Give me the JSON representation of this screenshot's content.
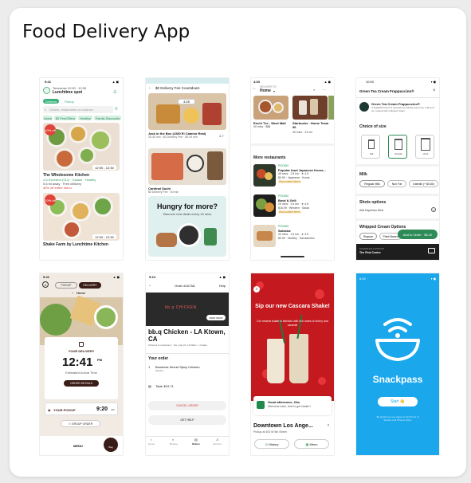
{
  "page": {
    "title": "Food Delivery App"
  },
  "s1": {
    "time": "9:41",
    "schedule": "Tomorrow 12:00 - 12:30",
    "place": "Lunchtime spot",
    "tabs": [
      "Delivery",
      "Pickup"
    ],
    "search_placeholder": "Dishes, restaurants or cuisines",
    "filters": [
      "Asian",
      "$0 Fee/Offers",
      "Healthy",
      "Family Discounts"
    ],
    "card1": {
      "promo": "40% off",
      "eta": "12:00 - 12:30",
      "name": "The Wholesome Kitchen",
      "rating": "4.8 Excellent (512) · Salads · Healthy",
      "meta": "0.6 mi away · Free delivery",
      "offer": "40% off entire menu"
    },
    "card2": {
      "promo": "20% off",
      "eta": "12:00 - 12:30",
      "name": "Shake Farm by Lunchtime Kitchen"
    }
  },
  "s2": {
    "header": "$0 Delivery Fee Countdown",
    "timer": "4:28",
    "item1": {
      "name": "Jack in the Box (2280 El Camino Real)",
      "meta": "25-40 min · $0 Delivery Fee · $0.49 min",
      "rating": "4.7"
    },
    "item2": {
      "name": "Cardinal Sushi",
      "meta": "$0 Delivery Fee · 40 min"
    },
    "promo": {
      "title": "Hungry for more?",
      "sub": "Discover new deals every 15 mins"
    }
  },
  "s3": {
    "time": "4:03",
    "deliver_label": "DELIVER TO",
    "location": "Home",
    "top1": {
      "name": "Enchi Tze · West Mall",
      "meta": "40 mins · $$$"
    },
    "top2": {
      "name": "Starbucks · Home Team 96",
      "meta": "30 mins · 3.5 mi"
    },
    "section": "More restaurants",
    "list": [
      {
        "tag": "PROMO",
        "name": "Popular food Japanese Korea...",
        "meta": "45 mins · 1.8 km · ★ 4.5",
        "meta2": "$9.99 · Japanese · Korea",
        "badge": "Discounted Items"
      },
      {
        "tag": "PROMO",
        "name": "Bowl & Grill",
        "meta": "25 mins · 1.6 km · ★ 4.6",
        "meta2": "$16.99 · Western · Salad",
        "badge": "Discounted Items"
      },
      {
        "tag": "PROMO",
        "name": "Salvatzz",
        "meta": "40 mins · 1.6 km · ★ 4.5",
        "meta2": "$9.99 · Healthy · Sandwiches",
        "badge": ""
      }
    ]
  },
  "s4": {
    "time": "10:00",
    "title": "Green Tea Cream Frappuccino®",
    "desc_title": "Green Tea Cream Frappuccino®",
    "desc": "A delightful blend of sweetened matcha green tea, milk and ice, topped with whipped cream.",
    "size_label": "Choice of size",
    "sizes": [
      "Tall",
      "Grande",
      "Venti"
    ],
    "milk_label": "Milk",
    "milks": [
      "Regular Milk",
      "Non Fat",
      "Oatmilk (+ $0.80)"
    ],
    "shots_label": "Shots options",
    "shots_item": "Add Espresso Shot",
    "cream_label": "Whipped Cream Options",
    "creams": [
      "Regular",
      "Plant-Based"
    ],
    "add_button": "Add to Order · $6.10",
    "footer_label": "SCHEDULE A PICKUP",
    "footer_place": "The Pink Centre",
    "colors": {
      "accent": "#2e8b57"
    }
  },
  "s5": {
    "time": "9:41",
    "tabs": [
      "PICKUP",
      "DELIVERY"
    ],
    "location": "Home",
    "card_label": "YOUR DELIVERY",
    "time_big": "12:41",
    "time_ampm": "PM",
    "arrival": "Estimated Arrival Time",
    "order_button": "ORDER DETAILS",
    "pickup_label": "YOUR PICKUP",
    "pickup_time": "9:20",
    "pickup_ampm": "AM",
    "group_button": "GROUP ORDER",
    "menu": "MENU",
    "bag": "Bag"
  },
  "s6": {
    "time": "9:24",
    "order": "Order #1A75A",
    "help": "Help",
    "view_shop": "VIEW SHOP",
    "brand": "bb.q CHICKEN",
    "name": "bb.q Chicken - LA Ktown, CA",
    "meta": "Ordered to restaurant · Tue, Aug 24, 10:49am · LA Eats",
    "your_order": "Your order",
    "qty": "1",
    "item": "Boneless Secret Spicy Chicken",
    "item_sub": "Medium",
    "total": "Total: $19.71",
    "cancel": "CANCEL ORDER",
    "get_help": "GET HELP",
    "nav": [
      "Home",
      "Browse",
      "Orders",
      "Account"
    ]
  },
  "s7": {
    "headline": "Sip our new Cascara Shake!",
    "sub": "Our newest shake is blended with rich notes of cherry and caramel",
    "greeting": "Good afternoon, Jiho",
    "welcome": "Welcome back, time to get shakin'!",
    "location": "Downtown Los Ange...",
    "pickup": "Pickup at 400 W 6th Street",
    "history": "History",
    "menu": "Menu"
  },
  "s8": {
    "time": "6:00",
    "brand": "Snackpass",
    "start": "Start 👋",
    "terms": "By signing up you agree to the Terms of Service and Privacy Policy",
    "colors": {
      "bg": "#1aa7ec"
    }
  }
}
